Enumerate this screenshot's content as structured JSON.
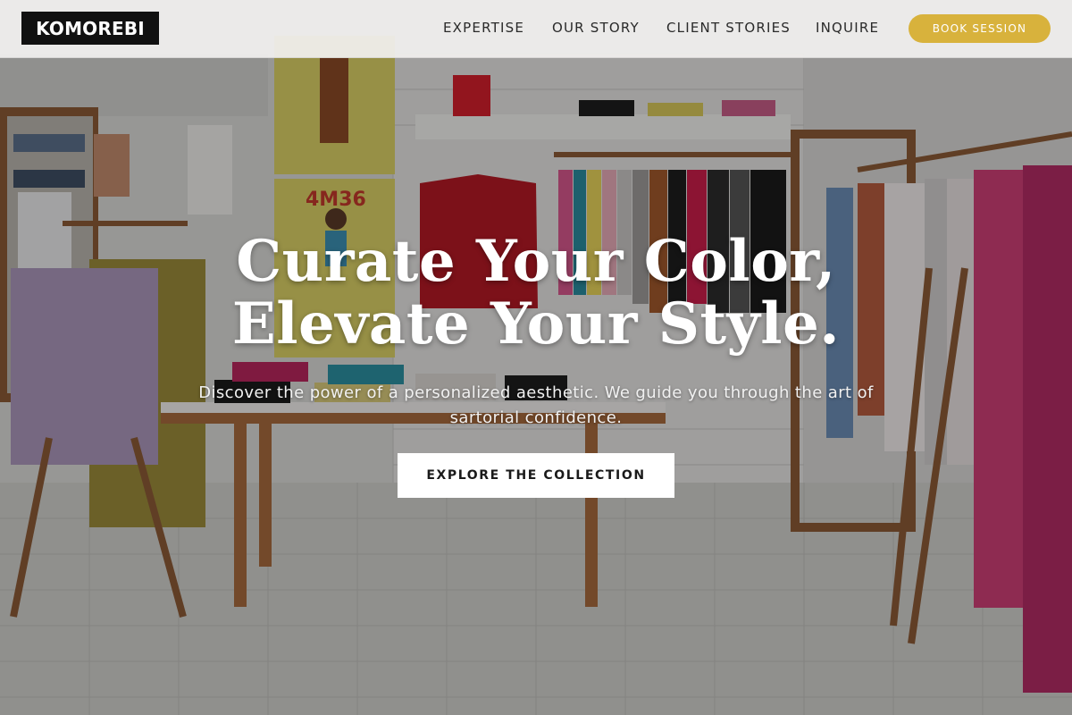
{
  "brand": {
    "logo_text": "KOMOREBI"
  },
  "nav": {
    "items": [
      {
        "label": "EXPERTISE"
      },
      {
        "label": "OUR STORY"
      },
      {
        "label": "CLIENT STORIES"
      },
      {
        "label": "INQUIRE"
      }
    ],
    "cta_label": "BOOK SESSION"
  },
  "hero": {
    "title_line1": "Curate Your Color,",
    "title_line2": "Elevate Your Style.",
    "subtitle_line1": "Discover the power of a personalized aesthetic. We guide you through the art of",
    "subtitle_line2": "sartorial confidence.",
    "cta_label": "EXPLORE THE COLLECTION",
    "background_image": "clothing-boutique-interior",
    "poster_text": "4M36"
  },
  "colors": {
    "accent": "#d8b23c",
    "header_bg": "#f2f1f0",
    "logo_bg": "#111111",
    "cta_bg": "#ffffff",
    "hero_text": "#ffffff"
  }
}
